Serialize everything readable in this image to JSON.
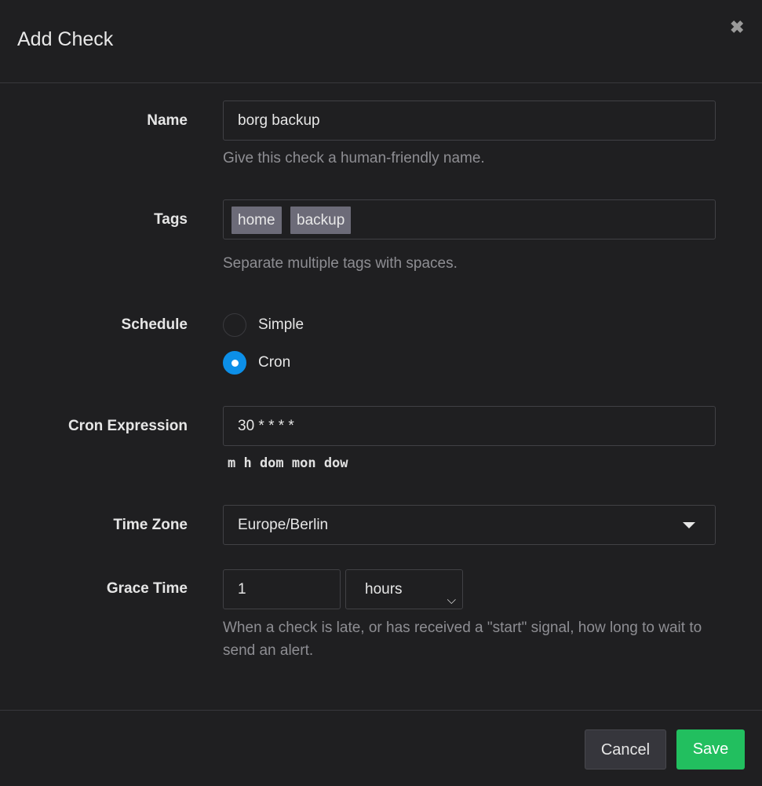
{
  "dialog": {
    "title": "Add Check",
    "close_icon": "close-icon"
  },
  "name": {
    "label": "Name",
    "value": "borg backup",
    "help": "Give this check a human-friendly name."
  },
  "tags": {
    "label": "Tags",
    "items": [
      "home",
      "backup"
    ],
    "help": "Separate multiple tags with spaces."
  },
  "schedule": {
    "label": "Schedule",
    "options": [
      {
        "label": "Simple",
        "selected": false
      },
      {
        "label": "Cron",
        "selected": true
      }
    ],
    "accent": "#0c8fe8"
  },
  "cron": {
    "label": "Cron Expression",
    "value": "30 * * * *",
    "hint": "m h dom mon dow"
  },
  "timezone": {
    "label": "Time Zone",
    "value": "Europe/Berlin"
  },
  "grace": {
    "label": "Grace Time",
    "value": "1",
    "unit": "hours",
    "help": "When a check is late, or has received a \"start\" signal, how long to wait to send an alert."
  },
  "footer": {
    "cancel": "Cancel",
    "save": "Save",
    "save_color": "#22bf5f"
  }
}
